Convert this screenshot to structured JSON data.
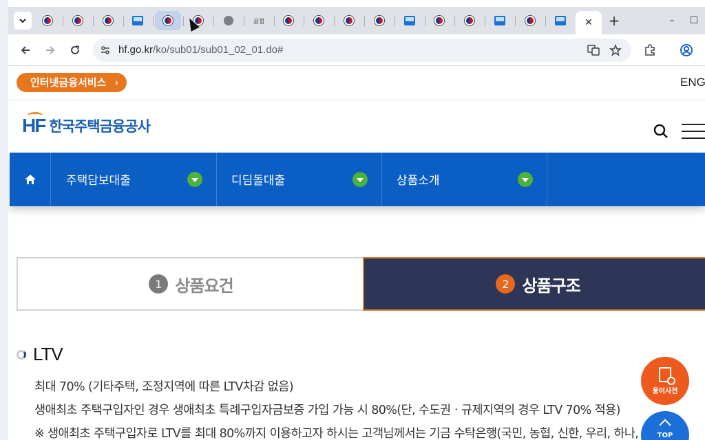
{
  "browser": {
    "tabs": [
      {
        "icon": "korea-gov-favicon"
      },
      {
        "icon": "korea-gov-favicon"
      },
      {
        "icon": "korea-gov-favicon"
      },
      {
        "icon": "hf-favicon"
      },
      {
        "icon": "korea-gov-favicon",
        "hover": true
      },
      {
        "icon": "korea-gov-favicon"
      },
      {
        "icon": "globe-favicon"
      },
      {
        "icon": "gov-text-favicon",
        "text": "공정"
      },
      {
        "icon": "korea-gov-favicon"
      },
      {
        "icon": "korea-gov-favicon"
      },
      {
        "icon": "korea-gov-favicon"
      },
      {
        "icon": "korea-gov-favicon"
      },
      {
        "icon": "hf-favicon"
      },
      {
        "icon": "korea-gov-favicon"
      },
      {
        "icon": "korea-gov-favicon"
      },
      {
        "icon": "hf-favicon"
      },
      {
        "icon": "korea-gov-favicon"
      },
      {
        "icon": "hf-favicon"
      }
    ],
    "active_tab_close": "✕",
    "new_tab": "+",
    "window_controls": {
      "minimize": "–",
      "maximize": "☐",
      "close": "✕"
    },
    "url_domain": "hf.go.kr",
    "url_path": "/ko/sub01/sub01_02_01.do#"
  },
  "topbar": {
    "internet_service_label": "인터넷금융서비스",
    "lang_label": "ENG"
  },
  "header": {
    "logo_mark": "HF",
    "logo_text": "한국주택금융공사"
  },
  "gnb": {
    "items": [
      {
        "label": "주택담보대출"
      },
      {
        "label": "디딤돌대출"
      },
      {
        "label": "상품소개"
      }
    ]
  },
  "steps": [
    {
      "num": "1",
      "label": "상품요건",
      "active": false
    },
    {
      "num": "2",
      "label": "상품구조",
      "active": true
    }
  ],
  "section": {
    "title": "LTV",
    "lines": [
      "최대 70% (기타주택, 조정지역에 따른 LTV차감 없음)",
      "생애최초 주택구입자인 경우 생애최초 특례구입자금보증 가입 가능 시 80%(단, 수도권ㆍ규제지역의 경우 LTV 70% 적용)",
      "※ 생애최초 주택구입자로 LTV를 최대 80%까지 이용하고자 하시는 고객님께서는 기금 수탁은행(국민, 농협, 신한, 우리, 하나,"
    ]
  },
  "floating": {
    "dictionary_label": "용어사전",
    "top_label": "TOP"
  },
  "colors": {
    "brand_blue": "#0a5ec4",
    "brand_orange": "#e8761e",
    "step_active_bg": "#2d3657"
  }
}
